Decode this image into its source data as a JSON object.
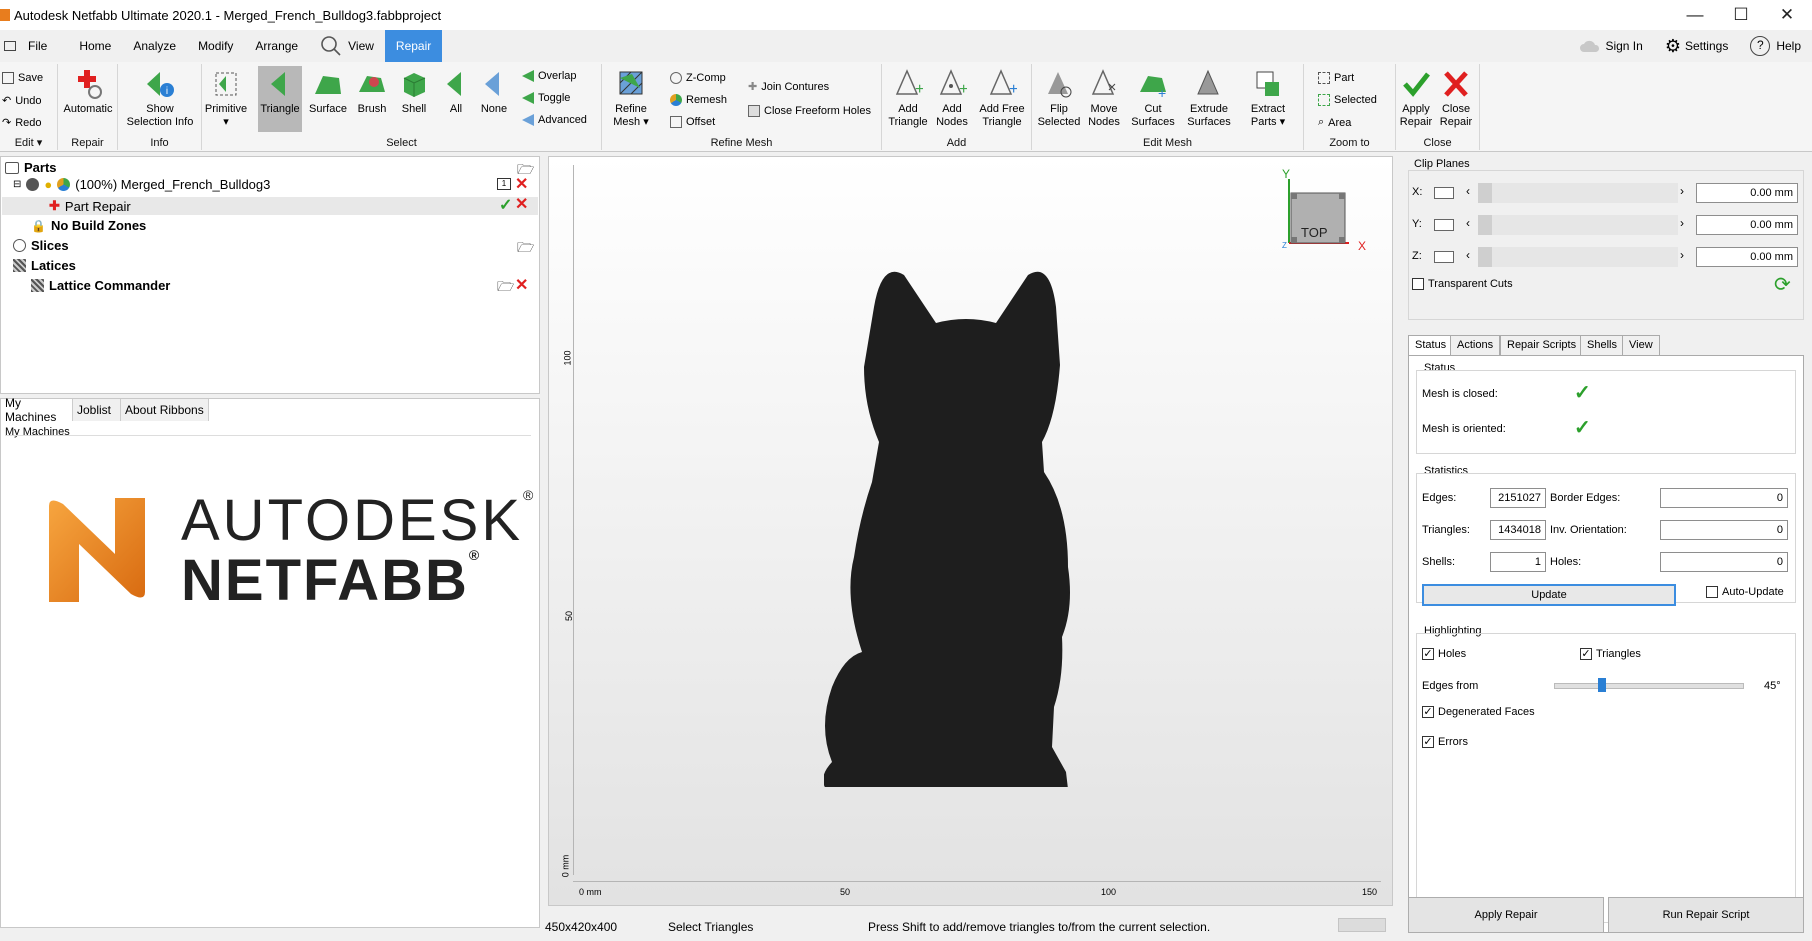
{
  "window": {
    "title": "Autodesk Netfabb Ultimate 2020.1 - Merged_French_Bulldog3.fabbproject"
  },
  "menu": {
    "file": "File",
    "home": "Home",
    "analyze": "Analyze",
    "modify": "Modify",
    "arrange": "Arrange",
    "view": "View",
    "repair": "Repair",
    "sign_in": "Sign In",
    "settings": "Settings",
    "help": "Help"
  },
  "ribbon": {
    "edit": {
      "save": "Save",
      "undo": "Undo",
      "redo": "Redo",
      "label": "Edit"
    },
    "repair": {
      "automatic": "Automatic",
      "label": "Repair"
    },
    "info": {
      "show_selection_info_1": "Show",
      "show_selection_info_2": "Selection Info",
      "label": "Info"
    },
    "select": {
      "primitive": "Primitive",
      "triangle": "Triangle",
      "surface": "Surface",
      "brush": "Brush",
      "shell": "Shell",
      "all": "All",
      "none": "None",
      "overlap": "Overlap",
      "toggle": "Toggle",
      "advanced": "Advanced",
      "label": "Select"
    },
    "refine": {
      "refine_mesh_1": "Refine",
      "refine_mesh_2": "Mesh",
      "zcomp": "Z-Comp",
      "remesh": "Remesh",
      "offset": "Offset",
      "join_contures": "Join Contures",
      "close_freeform_holes": "Close Freeform Holes",
      "label": "Refine Mesh"
    },
    "add": {
      "add_triangle_1": "Add",
      "add_triangle_2": "Triangle",
      "add_nodes_1": "Add",
      "add_nodes_2": "Nodes",
      "add_free_1": "Add Free",
      "add_free_2": "Triangle",
      "label": "Add"
    },
    "edit_mesh": {
      "flip_1": "Flip",
      "flip_2": "Selected",
      "move_1": "Move",
      "move_2": "Nodes",
      "cut_1": "Cut",
      "cut_2": "Surfaces",
      "extrude_1": "Extrude",
      "extrude_2": "Surfaces",
      "extract_1": "Extract",
      "extract_2": "Parts",
      "label": "Edit Mesh"
    },
    "zoom": {
      "part": "Part",
      "selected": "Selected",
      "area": "Area",
      "label": "Zoom to"
    },
    "close": {
      "apply_1": "Apply",
      "apply_2": "Repair",
      "close_1": "Close",
      "close_2": "Repair",
      "label": "Close"
    }
  },
  "parts_tree": {
    "parts": "Parts",
    "model": "(100%) Merged_French_Bulldog3",
    "part_repair": "Part Repair",
    "no_build": "No Build Zones",
    "slices": "Slices",
    "lattices": "Latices",
    "lattice_commander": "Lattice Commander"
  },
  "machines": {
    "tabs": [
      "My Machines",
      "Joblist",
      "About Ribbons"
    ],
    "group_label": "My Machines",
    "logo_line1": "AUTODESK",
    "logo_line2": "NETFABB"
  },
  "viewport": {
    "xaxis": [
      "0 mm",
      "50",
      "100",
      "150"
    ],
    "yaxis": [
      "0 mm",
      "50",
      "100"
    ],
    "cube_label": "TOP",
    "axis_x": "X",
    "axis_y": "Y",
    "axis_z": "Z"
  },
  "status_bar": {
    "dims": "450x420x400",
    "mode": "Select Triangles",
    "hint": "Press Shift to add/remove triangles to/from the current selection."
  },
  "clip_planes": {
    "title": "Clip Planes",
    "x_label": "X:",
    "y_label": "Y:",
    "z_label": "Z:",
    "x_val": "0.00 mm",
    "y_val": "0.00 mm",
    "z_val": "0.00 mm",
    "transparent": "Transparent Cuts"
  },
  "repair_tabs": [
    "Status",
    "Actions",
    "Repair Scripts",
    "Shells",
    "View"
  ],
  "status": {
    "title": "Status",
    "closed": "Mesh is closed:",
    "oriented": "Mesh is oriented:"
  },
  "statistics": {
    "title": "Statistics",
    "edges_label": "Edges:",
    "edges": "2151027",
    "border_edges_label": "Border Edges:",
    "border_edges": "0",
    "triangles_label": "Triangles:",
    "triangles": "1434018",
    "inv_orient_label": "Inv. Orientation:",
    "inv_orient": "0",
    "shells_label": "Shells:",
    "shells": "1",
    "holes_label": "Holes:",
    "holes": "0",
    "update": "Update",
    "auto_update": "Auto-Update"
  },
  "highlighting": {
    "title": "Highlighting",
    "holes": "Holes",
    "triangles": "Triangles",
    "edges_from": "Edges from",
    "angle": "45°",
    "angle_level": 0.25,
    "degenerated": "Degenerated Faces",
    "errors": "Errors"
  },
  "bottom_buttons": {
    "apply": "Apply Repair",
    "run_script": "Run Repair Script"
  },
  "colors": {
    "accent": "#3c8de0",
    "green": "#2ca02c",
    "red": "#e02020",
    "model": "#1e1e1e"
  }
}
